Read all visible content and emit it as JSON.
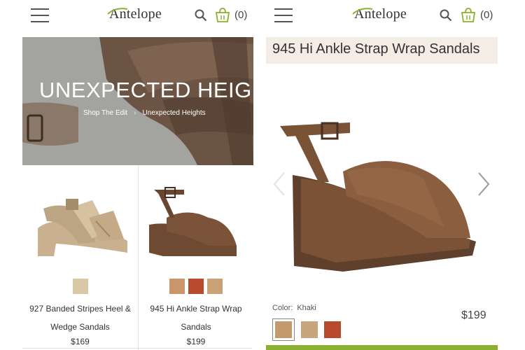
{
  "app": {
    "brand": "Antelope",
    "cart_count": "(0)"
  },
  "colors": {
    "accent_green": "#8bb030",
    "title_bar_bg": "#f3ede5"
  },
  "icons": {
    "menu": "hamburger-icon",
    "search": "search-icon",
    "cart": "shopping-basket-icon",
    "prev": "chevron-left-icon",
    "next": "chevron-right-icon"
  },
  "left": {
    "hero": {
      "title": "UNEXPECTED HEIGHTS",
      "breadcrumb": [
        "Shop The Edit",
        "Unexpected Heights"
      ]
    },
    "products": [
      {
        "name": "927 Banded Stripes Heel & Wedge Sandals",
        "price": "$169",
        "swatches": [
          "#d9c8a6"
        ]
      },
      {
        "name": "945 Hi Ankle Strap Wrap Sandals",
        "price": "$199",
        "swatches": [
          "#c8966a",
          "#b84a2e",
          "#c9a377"
        ]
      }
    ]
  },
  "right": {
    "title": "945 Hi Ankle Strap Wrap Sandals",
    "color_label": "Color:",
    "color_value": "Khaki",
    "price": "$199",
    "swatches": [
      "#c29a6c",
      "#c9a57d",
      "#b84a2e"
    ],
    "selected_swatch": 0
  }
}
